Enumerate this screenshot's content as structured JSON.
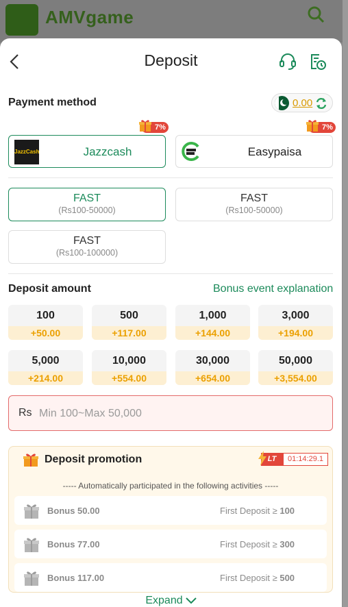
{
  "background_app": {
    "logo_text": "AMVgame"
  },
  "header": {
    "title": "Deposit"
  },
  "payment_method": {
    "title": "Payment method",
    "balance": "0.00",
    "methods": [
      {
        "label": "Jazzcash",
        "logo_text": "JazzCash",
        "badge": "7%",
        "active": true
      },
      {
        "label": "Easypaisa",
        "badge": "7%",
        "active": false
      }
    ]
  },
  "channels": [
    {
      "name": "FAST",
      "range": "(Rs100-50000)",
      "active": true
    },
    {
      "name": "FAST",
      "range": "(Rs100-50000)",
      "active": false
    },
    {
      "name": "FAST",
      "range": "(Rs100-100000)",
      "active": false
    }
  ],
  "deposit_amount": {
    "title": "Deposit amount",
    "bonus_link": "Bonus event explanation",
    "options": [
      {
        "value": "100",
        "bonus": "+50.00"
      },
      {
        "value": "500",
        "bonus": "+117.00"
      },
      {
        "value": "1,000",
        "bonus": "+144.00"
      },
      {
        "value": "3,000",
        "bonus": "+194.00"
      },
      {
        "value": "5,000",
        "bonus": "+214.00"
      },
      {
        "value": "10,000",
        "bonus": "+554.00"
      },
      {
        "value": "30,000",
        "bonus": "+654.00"
      },
      {
        "value": "50,000",
        "bonus": "+3,554.00"
      }
    ],
    "currency_prefix": "Rs",
    "placeholder": "Min 100~Max 50,000"
  },
  "promotion": {
    "title": "Deposit promotion",
    "tag": "LT",
    "timer": "01:14:29.1",
    "subtitle": "----- Automatically participated in the following activities -----",
    "items": [
      {
        "name": "Bonus 50.00",
        "condition": "First Deposit ≥",
        "amount": "100"
      },
      {
        "name": "Bonus 77.00",
        "condition": "First Deposit ≥",
        "amount": "300"
      },
      {
        "name": "Bonus 117.00",
        "condition": "First Deposit ≥",
        "amount": "500"
      }
    ],
    "expand_label": "Expand"
  },
  "colors": {
    "accent": "#1b8a5a",
    "bonus": "#eba000",
    "alert": "#e2463a"
  }
}
